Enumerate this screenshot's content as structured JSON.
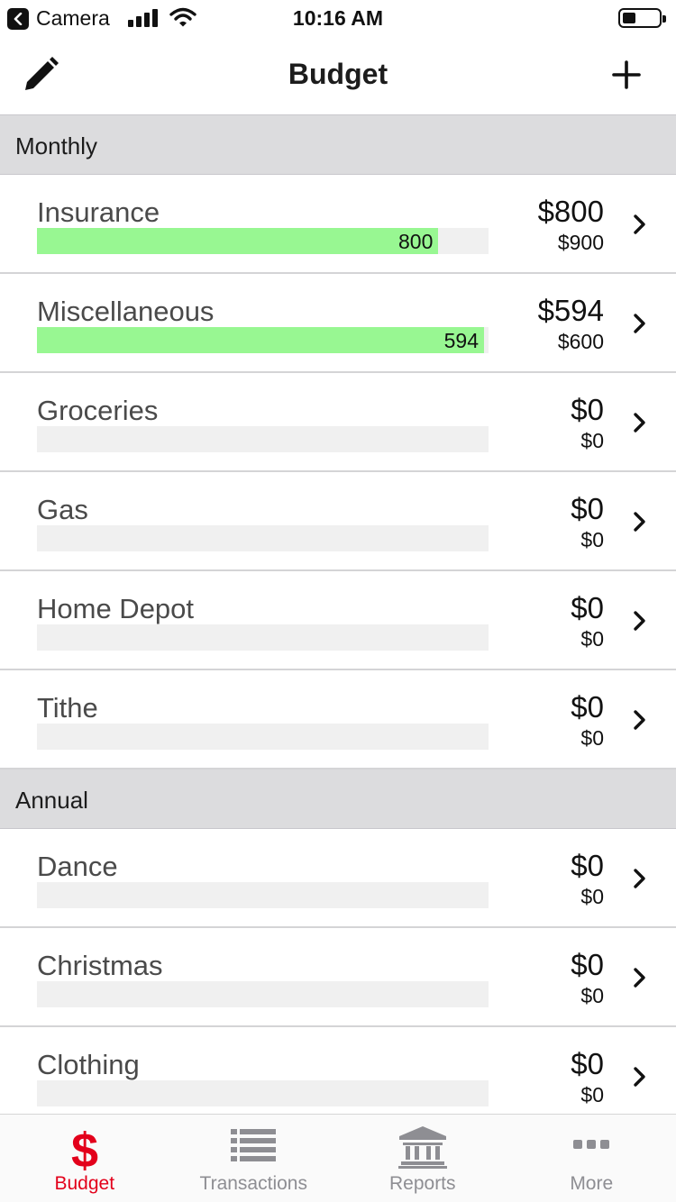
{
  "status_bar": {
    "back_app": "Camera",
    "time": "10:16 AM",
    "battery_level": 0.35
  },
  "nav": {
    "title": "Budget",
    "left_icon": "pencil-icon",
    "right_icon": "plus-icon"
  },
  "sections": [
    {
      "title": "Monthly",
      "items": [
        {
          "name": "Insurance",
          "spent": "$800",
          "budget": "$900",
          "bar_label": "800",
          "fill": 0.889
        },
        {
          "name": "Miscellaneous",
          "spent": "$594",
          "budget": "$600",
          "bar_label": "594",
          "fill": 0.99
        },
        {
          "name": "Groceries",
          "spent": "$0",
          "budget": "$0",
          "bar_label": "",
          "fill": 0
        },
        {
          "name": "Gas",
          "spent": "$0",
          "budget": "$0",
          "bar_label": "",
          "fill": 0
        },
        {
          "name": "Home Depot",
          "spent": "$0",
          "budget": "$0",
          "bar_label": "",
          "fill": 0
        },
        {
          "name": "Tithe",
          "spent": "$0",
          "budget": "$0",
          "bar_label": "",
          "fill": 0
        }
      ]
    },
    {
      "title": "Annual",
      "items": [
        {
          "name": "Dance",
          "spent": "$0",
          "budget": "$0",
          "bar_label": "",
          "fill": 0
        },
        {
          "name": "Christmas",
          "spent": "$0",
          "budget": "$0",
          "bar_label": "",
          "fill": 0
        },
        {
          "name": "Clothing",
          "spent": "$0",
          "budget": "$0",
          "bar_label": "",
          "fill": 0
        }
      ]
    }
  ],
  "tabs": [
    {
      "label": "Budget",
      "icon": "dollar-icon",
      "active": true
    },
    {
      "label": "Transactions",
      "icon": "list-icon",
      "active": false
    },
    {
      "label": "Reports",
      "icon": "bank-icon",
      "active": false
    },
    {
      "label": "More",
      "icon": "more-icon",
      "active": false
    }
  ],
  "colors": {
    "accent": "#e3001b",
    "progress_fill": "#98f792",
    "progress_track": "#f0f0f0",
    "section_header": "#dcdcde",
    "tab_inactive": "#8e8e93"
  }
}
